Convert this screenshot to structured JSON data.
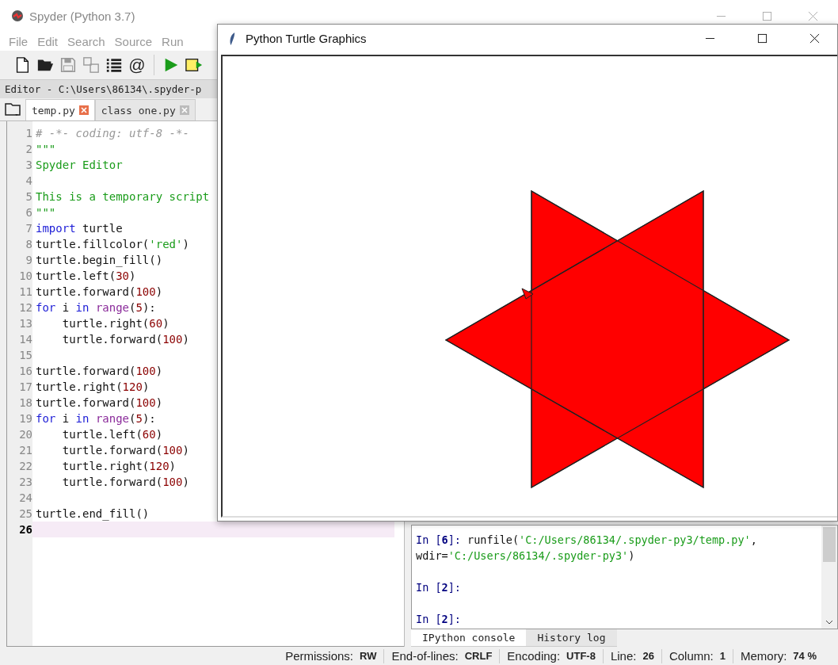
{
  "window": {
    "title": "Spyder (Python 3.7)"
  },
  "menu": [
    "File",
    "Edit",
    "Search",
    "Source",
    "Run"
  ],
  "toolbar": {
    "at_sign": "@"
  },
  "editor": {
    "title": "Editor - C:\\Users\\86134\\.spyder-p",
    "tabs": [
      {
        "label": "temp.py",
        "selected": true
      },
      {
        "label": "class one.py",
        "selected": false
      }
    ],
    "lines": [
      {
        "number": "1",
        "current": false,
        "tokens": [
          {
            "kind": "comment",
            "text": "# -*- coding: utf-8 -*-"
          }
        ]
      },
      {
        "number": "2",
        "current": false,
        "tokens": [
          {
            "kind": "string",
            "text": "\"\"\""
          }
        ]
      },
      {
        "number": "3",
        "current": false,
        "tokens": [
          {
            "kind": "string",
            "text": "Spyder Editor"
          }
        ]
      },
      {
        "number": "4",
        "current": false
      },
      {
        "number": "5",
        "current": false,
        "tokens": [
          {
            "kind": "string",
            "text": "This is a temporary script"
          }
        ]
      },
      {
        "number": "6",
        "current": false,
        "tokens": [
          {
            "kind": "string",
            "text": "\"\"\""
          }
        ]
      },
      {
        "number": "7",
        "current": false,
        "tokens": [
          {
            "kind": "keyword",
            "text": "import"
          },
          {
            "kind": "plain",
            "text": " turtle"
          }
        ]
      },
      {
        "number": "8",
        "current": false,
        "tokens": [
          {
            "kind": "plain",
            "text": "turtle.fillcolor("
          },
          {
            "kind": "string",
            "text": "'red'"
          },
          {
            "kind": "plain",
            "text": ")"
          }
        ]
      },
      {
        "number": "9",
        "current": false,
        "tokens": [
          {
            "kind": "plain",
            "text": "turtle.begin_fill()"
          }
        ]
      },
      {
        "number": "10",
        "current": false,
        "tokens": [
          {
            "kind": "plain",
            "text": "turtle.left("
          },
          {
            "kind": "number",
            "text": "30"
          },
          {
            "kind": "plain",
            "text": ")"
          }
        ]
      },
      {
        "number": "11",
        "current": false,
        "tokens": [
          {
            "kind": "plain",
            "text": "turtle.forward("
          },
          {
            "kind": "number",
            "text": "100"
          },
          {
            "kind": "plain",
            "text": ")"
          }
        ]
      },
      {
        "number": "12",
        "current": false,
        "tokens": [
          {
            "kind": "keyword",
            "text": "for"
          },
          {
            "kind": "plain",
            "text": " i "
          },
          {
            "kind": "keyword",
            "text": "in "
          },
          {
            "kind": "builtin",
            "text": "range"
          },
          {
            "kind": "plain",
            "text": "("
          },
          {
            "kind": "number",
            "text": "5"
          },
          {
            "kind": "plain",
            "text": "):"
          }
        ]
      },
      {
        "number": "13",
        "current": false,
        "tokens": [
          {
            "kind": "plain",
            "text": "    turtle.right("
          },
          {
            "kind": "number",
            "text": "60"
          },
          {
            "kind": "plain",
            "text": ")"
          }
        ]
      },
      {
        "number": "14",
        "current": false,
        "tokens": [
          {
            "kind": "plain",
            "text": "    turtle.forward("
          },
          {
            "kind": "number",
            "text": "100"
          },
          {
            "kind": "plain",
            "text": ")"
          }
        ]
      },
      {
        "number": "15",
        "current": false
      },
      {
        "number": "16",
        "current": false,
        "tokens": [
          {
            "kind": "plain",
            "text": "turtle.forward("
          },
          {
            "kind": "number",
            "text": "100"
          },
          {
            "kind": "plain",
            "text": ")"
          }
        ]
      },
      {
        "number": "17",
        "current": false,
        "tokens": [
          {
            "kind": "plain",
            "text": "turtle.right("
          },
          {
            "kind": "number",
            "text": "120"
          },
          {
            "kind": "plain",
            "text": ")"
          }
        ]
      },
      {
        "number": "18",
        "current": false,
        "tokens": [
          {
            "kind": "plain",
            "text": "turtle.forward("
          },
          {
            "kind": "number",
            "text": "100"
          },
          {
            "kind": "plain",
            "text": ")"
          }
        ]
      },
      {
        "number": "19",
        "current": false,
        "tokens": [
          {
            "kind": "keyword",
            "text": "for"
          },
          {
            "kind": "plain",
            "text": " i "
          },
          {
            "kind": "keyword",
            "text": "in "
          },
          {
            "kind": "builtin",
            "text": "range"
          },
          {
            "kind": "plain",
            "text": "("
          },
          {
            "kind": "number",
            "text": "5"
          },
          {
            "kind": "plain",
            "text": "):"
          }
        ]
      },
      {
        "number": "20",
        "current": false,
        "tokens": [
          {
            "kind": "plain",
            "text": "    turtle.left("
          },
          {
            "kind": "number",
            "text": "60"
          },
          {
            "kind": "plain",
            "text": ")"
          }
        ]
      },
      {
        "number": "21",
        "current": false,
        "tokens": [
          {
            "kind": "plain",
            "text": "    turtle.forward("
          },
          {
            "kind": "number",
            "text": "100"
          },
          {
            "kind": "plain",
            "text": ")"
          }
        ]
      },
      {
        "number": "22",
        "current": false,
        "tokens": [
          {
            "kind": "plain",
            "text": "    turtle.right("
          },
          {
            "kind": "number",
            "text": "120"
          },
          {
            "kind": "plain",
            "text": ")"
          }
        ]
      },
      {
        "number": "23",
        "current": false,
        "tokens": [
          {
            "kind": "plain",
            "text": "    turtle.forward("
          },
          {
            "kind": "number",
            "text": "100"
          },
          {
            "kind": "plain",
            "text": ")"
          }
        ]
      },
      {
        "number": "24",
        "current": false
      },
      {
        "number": "25",
        "current": false,
        "tokens": [
          {
            "kind": "plain",
            "text": "turtle.end_fill()"
          }
        ]
      },
      {
        "number": "26",
        "current": true
      }
    ]
  },
  "console": {
    "blocks": [
      {
        "lines": [
          {
            "tokens": [
              {
                "kind": "prompt",
                "text": "In ["
              },
              {
                "kind": "prompt-num",
                "text": "6"
              },
              {
                "kind": "prompt",
                "text": "]:"
              },
              {
                "kind": "plain",
                "text": " runfile("
              },
              {
                "kind": "string",
                "text": "'C:/Users/86134/.spyder-py3/temp.py'"
              },
              {
                "kind": "plain",
                "text": ","
              }
            ]
          },
          {
            "tokens": [
              {
                "kind": "plain",
                "text": "wdir="
              },
              {
                "kind": "string",
                "text": "'C:/Users/86134/.spyder-py3'"
              },
              {
                "kind": "plain",
                "text": ")"
              }
            ]
          }
        ]
      },
      {
        "lines": [
          {
            "tokens": [
              {
                "kind": "prompt",
                "text": "In ["
              },
              {
                "kind": "prompt-num",
                "text": "2"
              },
              {
                "kind": "prompt",
                "text": "]:"
              }
            ]
          }
        ]
      },
      {
        "lines": [
          {
            "tokens": [
              {
                "kind": "prompt",
                "text": "In ["
              },
              {
                "kind": "prompt-num",
                "text": "2"
              },
              {
                "kind": "prompt",
                "text": "]:"
              }
            ]
          }
        ]
      }
    ],
    "tabs": [
      {
        "label": "IPython console",
        "selected": true
      },
      {
        "label": "History log",
        "selected": false
      }
    ]
  },
  "status_bar": [
    {
      "label": "Permissions:",
      "value": "RW"
    },
    {
      "label": "End-of-lines:",
      "value": "CRLF"
    },
    {
      "label": "Encoding:",
      "value": "UTF-8"
    },
    {
      "label": "Line:",
      "value": "26"
    },
    {
      "label": "Column:",
      "value": "1"
    },
    {
      "label": "Memory:",
      "value": "74 %"
    }
  ],
  "turtle_window": {
    "title": "Python Turtle Graphics"
  }
}
